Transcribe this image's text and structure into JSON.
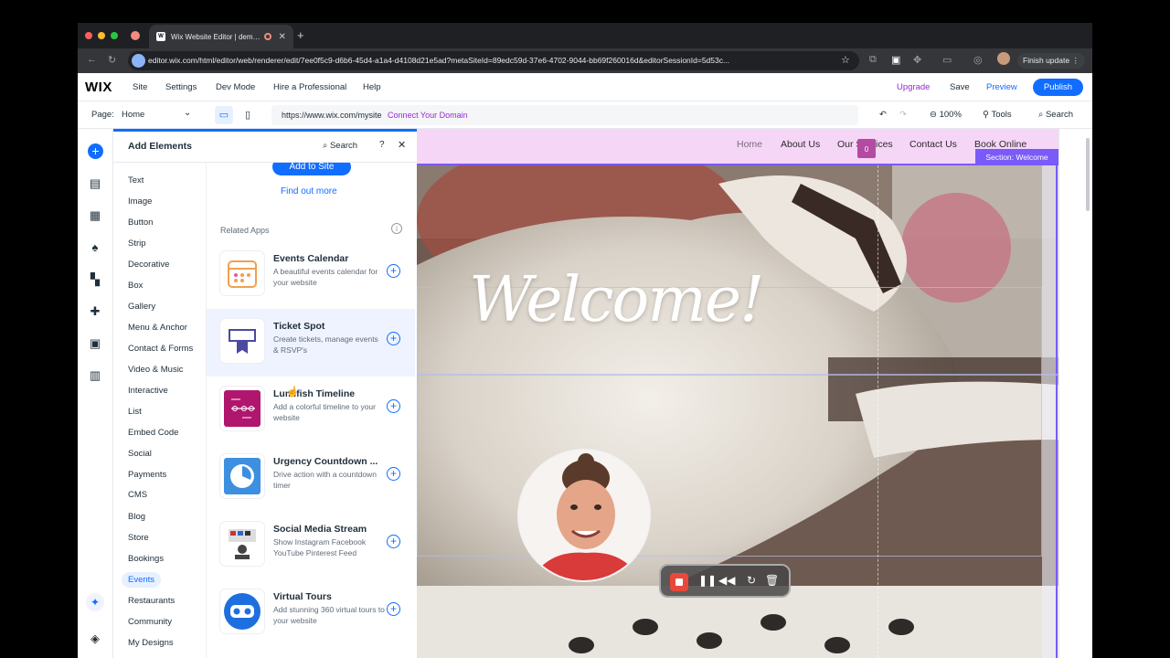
{
  "browser": {
    "tab_title": "Wix Website Editor | dem…",
    "url": "editor.wix.com/html/editor/web/renderer/edit/7ee0f5c9-d6b6-45d4-a1a4-d4108d21e5ad?metaSiteId=89edc59d-37e6-4702-9044-bb69f260016d&editorSessionId=5d53c...",
    "finish_update": "Finish update"
  },
  "topbar": {
    "logo": "WIX",
    "menu": [
      "Site",
      "Settings",
      "Dev Mode",
      "Hire a Professional",
      "Help"
    ],
    "upgrade": "Upgrade",
    "save": "Save",
    "preview": "Preview",
    "publish": "Publish"
  },
  "toolbar": {
    "page_label": "Page:",
    "page_value": "Home",
    "site_url": "https://www.wix.com/mysite",
    "connect_domain": "Connect Your Domain",
    "zoom": "100%",
    "tools": "Tools",
    "search": "Search"
  },
  "panel": {
    "title": "Add Elements",
    "search": "Search",
    "help": "?",
    "categories": [
      "Text",
      "Image",
      "Button",
      "Strip",
      "Decorative",
      "Box",
      "Gallery",
      "Menu & Anchor",
      "Contact & Forms",
      "Video & Music",
      "Interactive",
      "List",
      "Embed Code",
      "Social",
      "Payments",
      "CMS",
      "Blog",
      "Store",
      "Bookings",
      "Events",
      "Restaurants",
      "Community",
      "My Designs"
    ],
    "selected_category": "Events",
    "add_to_site": "Add to Site",
    "find_out_more": "Find out more",
    "related_apps_label": "Related Apps",
    "apps": [
      {
        "name": "Events Calendar",
        "desc": "A beautiful events calendar for your website"
      },
      {
        "name": "Ticket Spot",
        "desc": "Create tickets, manage events & RSVP's"
      },
      {
        "name": "Lumifish Timeline",
        "desc": "Add a colorful timeline to your website"
      },
      {
        "name": "Urgency Countdown ...",
        "desc": "Drive action with a countdown timer"
      },
      {
        "name": "Social Media Stream",
        "desc": "Show Instagram Facebook YouTube Pinterest Feed"
      },
      {
        "name": "Virtual Tours",
        "desc": "Add stunning 360 virtual tours to your website"
      }
    ]
  },
  "site": {
    "nav": [
      "Home",
      "About Us",
      "Our Services",
      "Contact Us",
      "Book Online"
    ],
    "cart_count": "0",
    "section_label": "Section: Welcome",
    "heading": "Welcome!"
  },
  "colors": {
    "accent": "#116dff",
    "upgrade": "#9a27d5",
    "header_bg": "#f6d6f6",
    "section_purple": "#7a5af8"
  }
}
